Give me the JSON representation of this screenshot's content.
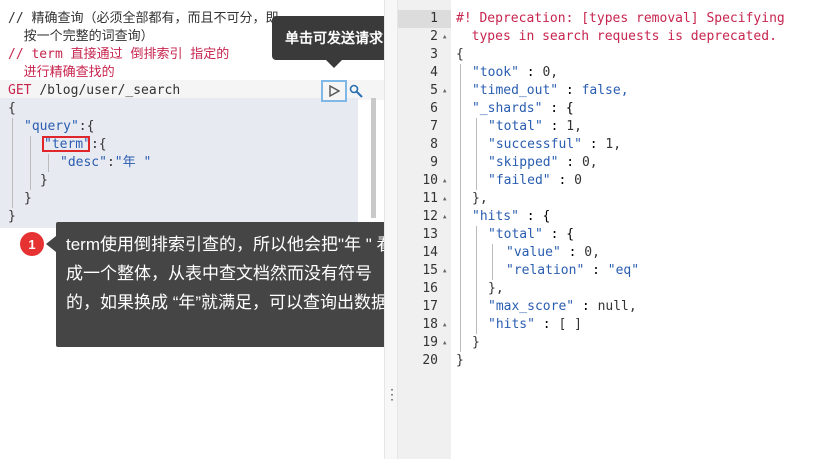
{
  "request_editor": {
    "comment_1": "// 精确查询（必须全部都有，而且不可分，即",
    "comment_1b": "  按一个完整的词查询）",
    "comment_2": "// term 直接通过 倒排索引 指定的",
    "comment_2b": "  进行精确查找的",
    "method": "GET",
    "path": "/blog/user/_search",
    "brace_open": "{",
    "query_key": "\"query\"",
    "term_key": "\"term\"",
    "desc_key": "\"desc\"",
    "desc_value": "\"年 \"",
    "brace_close": "}"
  },
  "tooltips": {
    "send_request": "单击可发送请求"
  },
  "callout": {
    "badge": "1",
    "text": "term使用倒排索引查的，所以他会把\"年  \" 看成一个整体，从表中查文档然而没有符号的，如果换成 “年”就满足，可以查询出数据"
  },
  "response": {
    "line_numbers": [
      "1",
      "2",
      "3",
      "4",
      "5",
      "6",
      "7",
      "8",
      "9",
      "10",
      "11",
      "12",
      "13",
      "14",
      "15",
      "16",
      "17",
      "18",
      "19",
      "20"
    ],
    "deprecation_1": "#! Deprecation: [types removal] Specifying",
    "deprecation_2": "  types in search requests is deprecated.",
    "open": "{",
    "took_key": "\"took\"",
    "took_val": "0,",
    "timed_out_key": "\"timed_out\"",
    "timed_out_val": "false,",
    "shards_key": "\"_shards\"",
    "total_key": "\"total\"",
    "total_val": "1,",
    "successful_key": "\"successful\"",
    "successful_val": "1,",
    "skipped_key": "\"skipped\"",
    "skipped_val": "0,",
    "failed_key": "\"failed\"",
    "failed_val": "0",
    "hits_key": "\"hits\"",
    "value_key": "\"value\"",
    "value_val": "0,",
    "relation_key": "\"relation\"",
    "relation_val": "\"eq\"",
    "max_score_key": "\"max_score\"",
    "max_score_val": "null,",
    "hits_arr": "[ ]"
  }
}
